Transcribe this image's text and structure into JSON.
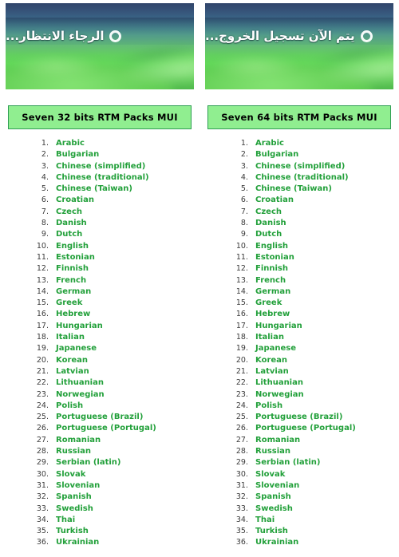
{
  "colors": {
    "list_text_green": "#22a03a",
    "title_box_fill": "#90ee90",
    "title_box_border": "#2f9e54",
    "number_gray": "#3b3b3b",
    "status_text_white": "#ffffff"
  },
  "panels": [
    {
      "id": "seven-32",
      "thumbnail": {
        "status_text": "الرجاء الانتظار...",
        "spinner_icon": "ring-spinner-icon"
      },
      "title": "Seven 32 bits RTM Packs MUI",
      "languages": [
        "Arabic",
        "Bulgarian",
        "Chinese (simplified)",
        "Chinese (traditional)",
        "Chinese (Taiwan)",
        "Croatian",
        "Czech",
        "Danish",
        "Dutch",
        "English",
        "Estonian",
        "Finnish",
        "French",
        "German",
        "Greek",
        "Hebrew",
        "Hungarian",
        "Italian",
        "Japanese",
        "Korean",
        "Latvian",
        "Lithuanian",
        "Norwegian",
        "Polish",
        "Portuguese (Brazil)",
        "Portuguese (Portugal)",
        "Romanian",
        "Russian",
        "Serbian (latin)",
        "Slovak",
        "Slovenian",
        "Spanish",
        "Swedish",
        "Thai",
        "Turkish",
        "Ukrainian"
      ]
    },
    {
      "id": "seven-64",
      "thumbnail": {
        "status_text": "يتم الآن تسجيل الخروج...",
        "spinner_icon": "ring-spinner-icon"
      },
      "title": "Seven 64 bits RTM Packs MUI",
      "languages": [
        "Arabic",
        "Bulgarian",
        "Chinese (simplified)",
        "Chinese (traditional)",
        "Chinese (Taiwan)",
        "Croatian",
        "Czech",
        "Danish",
        "Dutch",
        "English",
        "Estonian",
        "Finnish",
        "French",
        "German",
        "Greek",
        "Hebrew",
        "Hungarian",
        "Italian",
        "Japanese",
        "Korean",
        "Latvian",
        "Lithuanian",
        "Norwegian",
        "Polish",
        "Portuguese (Brazil)",
        "Portuguese (Portugal)",
        "Romanian",
        "Russian",
        "Serbian (latin)",
        "Slovak",
        "Slovenian",
        "Spanish",
        "Swedish",
        "Thai",
        "Turkish",
        "Ukrainian"
      ]
    }
  ]
}
